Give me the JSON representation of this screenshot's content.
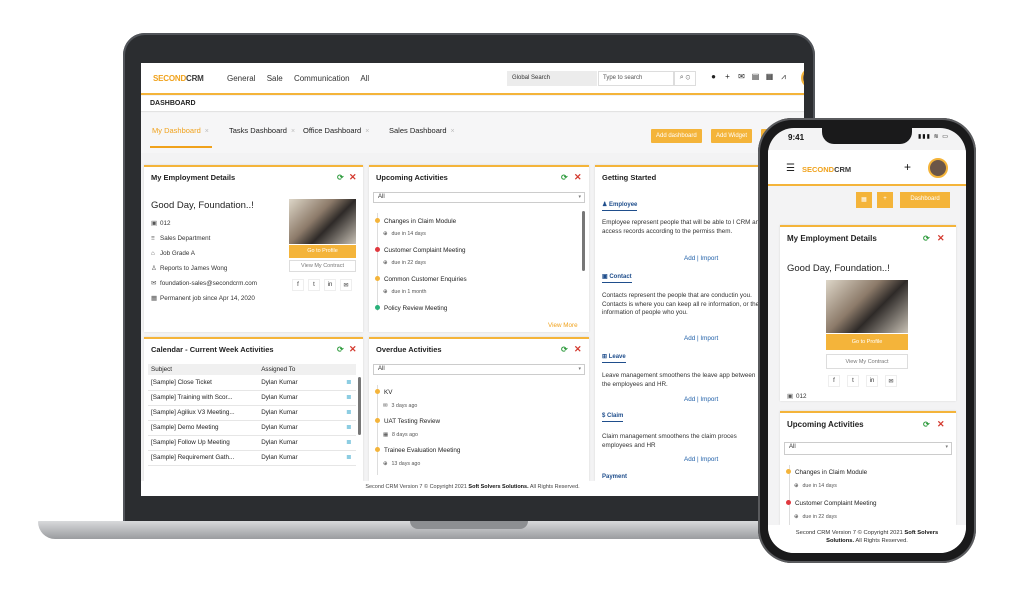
{
  "app": {
    "logo_a": "SECOND",
    "logo_b": "CRM"
  },
  "topnav": {
    "items": [
      "General",
      "Sale",
      "Communication",
      "All"
    ],
    "global_search_label": "Global Search",
    "search_placeholder": "Type to search"
  },
  "breadcrumb": "DASHBOARD",
  "tabs": [
    {
      "label": "My Dashboard",
      "active": true
    },
    {
      "label": "Tasks Dashboard"
    },
    {
      "label": "Office Dashboard"
    },
    {
      "label": "Sales Dashboard"
    }
  ],
  "buttons": {
    "add_dashboard": "Add dashboard",
    "add_widget": "Add Widget"
  },
  "employment": {
    "title": "My Employment Details",
    "greeting": "Good Day, Foundation..!",
    "id": "012",
    "department": "Sales Department",
    "grade": "Job Grade A",
    "reports_to": "Reports to James Wong",
    "email": "foundation-sales@secondcrm.com",
    "status": "Permanent job since Apr 14, 2020",
    "go_to_profile": "Go to Profile",
    "view_contract": "View My Contract",
    "social": [
      "f",
      "t",
      "in",
      "✉"
    ]
  },
  "upcoming": {
    "title": "Upcoming Activities",
    "filter": "All",
    "items": [
      {
        "name": "Changes in Claim Module",
        "due": "due in 14 days",
        "color": "#f4b43a"
      },
      {
        "name": "Customer Complaint Meeting",
        "due": "due in 22 days",
        "color": "#e0383e"
      },
      {
        "name": "Common Customer Enquiries",
        "due": "due in 1 month",
        "color": "#f4b43a"
      },
      {
        "name": "Policy Review Meeting",
        "due": "",
        "color": "#2ab07a"
      }
    ],
    "view_more": "View More"
  },
  "getting_started": {
    "title": "Getting Started",
    "sections": [
      {
        "head": "Employee",
        "text": "Employee represent people that will be able to l CRM and access records according to the permiss them."
      },
      {
        "head": "Contact",
        "text": "Contacts represent the people that are conductin you. Contacts is where you can keep all re information, or the information of people who you."
      },
      {
        "head": "Leave",
        "text": "Leave management smoothens the leave app between the employees and HR."
      },
      {
        "head": "Claim",
        "text": "Claim management smoothens the claim proces employees and HR"
      }
    ],
    "add": "Add",
    "sep": "|",
    "import": "Import",
    "partial_head": "Payment"
  },
  "calendar": {
    "title": "Calendar - Current Week Activities",
    "columns": [
      "Subject",
      "Assigned To"
    ],
    "rows": [
      [
        "[Sample] Close Ticket",
        "Dylan Kumar"
      ],
      [
        "[Sample] Training with Scor...",
        "Dylan Kumar"
      ],
      [
        "[Sample] Agiliux V3 Meeting...",
        "Dylan Kumar"
      ],
      [
        "[Sample] Demo Meeting",
        "Dylan Kumar"
      ],
      [
        "[Sample] Follow Up Meeting",
        "Dylan Kumar"
      ],
      [
        "[Sample] Requirement Gath...",
        "Dylan Kumar"
      ]
    ]
  },
  "overdue": {
    "title": "Overdue Activities",
    "filter": "All",
    "items": [
      {
        "name": "KV",
        "ago": "3 days ago",
        "color": "#f4b43a"
      },
      {
        "name": "UAT Testing Review",
        "ago": "8 days ago",
        "color": "#f4b43a"
      },
      {
        "name": "Trainee Evaluation Meeting",
        "ago": "13 days ago",
        "color": "#f4b43a"
      }
    ]
  },
  "footer": {
    "prefix": "Second CRM Version 7 © Copyright 2021",
    "company": "Soft Solvers Solutions.",
    "suffix": "All Rights Reserved."
  },
  "phone": {
    "time": "9:41",
    "status": "▮▮▮ ≋ ▭",
    "dashboard_btn": "Dashboard",
    "footer_line1a": "Second CRM Version 7 © Copyright 2021",
    "footer_line1b": "Soft Solvers",
    "footer_line2a": "Solutions.",
    "footer_line2b": "All Rights Reserved."
  },
  "colors": {
    "accent": "#f4b43a",
    "link": "#1f5fa8",
    "ok": "#2e9b3d",
    "close": "#d43a2f"
  }
}
